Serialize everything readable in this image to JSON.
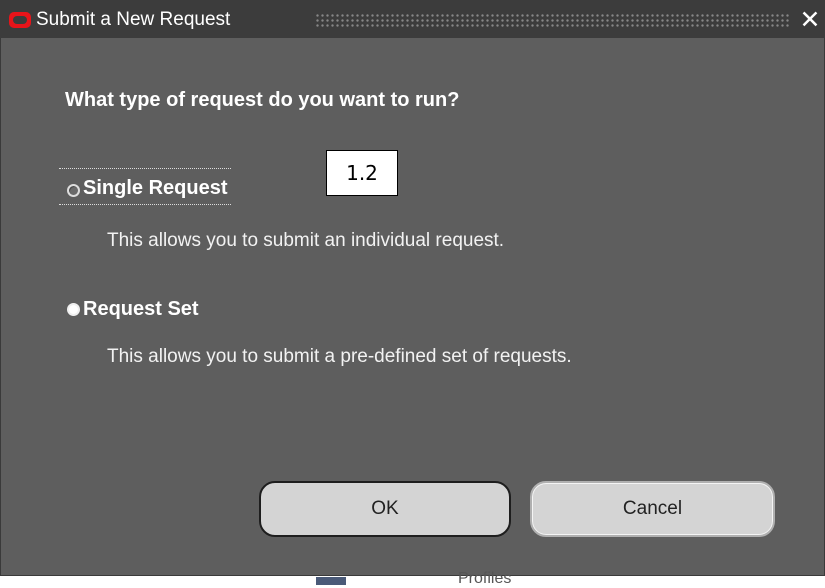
{
  "window": {
    "title": "Submit a New Request",
    "logo_icon": "oracle-logo-icon",
    "close_icon": "close-icon",
    "close_glyph": "✕",
    "accent_color": "#e8141a"
  },
  "dialog": {
    "question": "What type of request do you want to run?",
    "options": [
      {
        "label": "Single Request",
        "description": "This allows you to submit an individual request.",
        "selected": false,
        "focused": true
      },
      {
        "label": "Request Set",
        "description": "This allows you to submit a pre-defined set of requests.",
        "selected": true,
        "focused": false
      }
    ],
    "ok_label": "OK",
    "cancel_label": "Cancel"
  },
  "annotation": {
    "callout_text": "1.2"
  },
  "background_partial_text": "Profiles"
}
